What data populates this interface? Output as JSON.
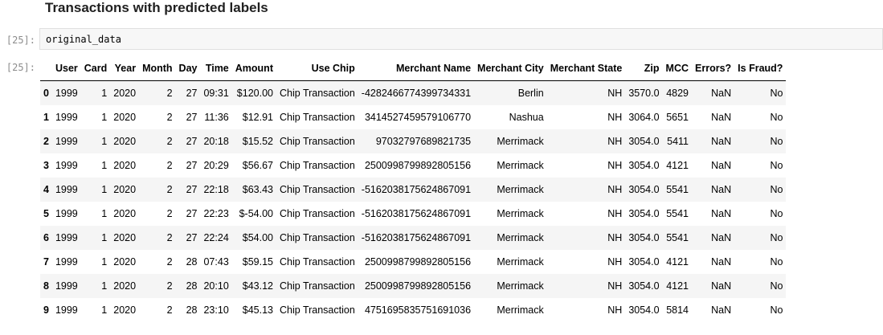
{
  "heading": "Transactions with predicted labels",
  "cell": {
    "in_prompt": "[25]:",
    "code": "original_data",
    "out_prompt": "[25]:"
  },
  "table": {
    "columns": [
      "",
      "User",
      "Card",
      "Year",
      "Month",
      "Day",
      "Time",
      "Amount",
      "Use Chip",
      "Merchant Name",
      "Merchant City",
      "Merchant State",
      "Zip",
      "MCC",
      "Errors?",
      "Is Fraud?"
    ],
    "rows": [
      [
        "0",
        "1999",
        "1",
        "2020",
        "2",
        "27",
        "09:31",
        "$120.00",
        "Chip Transaction",
        "-4282466774399734331",
        "Berlin",
        "NH",
        "3570.0",
        "4829",
        "NaN",
        "No"
      ],
      [
        "1",
        "1999",
        "1",
        "2020",
        "2",
        "27",
        "11:36",
        "$12.91",
        "Chip Transaction",
        "3414527459579106770",
        "Nashua",
        "NH",
        "3064.0",
        "5651",
        "NaN",
        "No"
      ],
      [
        "2",
        "1999",
        "1",
        "2020",
        "2",
        "27",
        "20:18",
        "$15.52",
        "Chip Transaction",
        "97032797689821735",
        "Merrimack",
        "NH",
        "3054.0",
        "5411",
        "NaN",
        "No"
      ],
      [
        "3",
        "1999",
        "1",
        "2020",
        "2",
        "27",
        "20:29",
        "$56.67",
        "Chip Transaction",
        "2500998799892805156",
        "Merrimack",
        "NH",
        "3054.0",
        "4121",
        "NaN",
        "No"
      ],
      [
        "4",
        "1999",
        "1",
        "2020",
        "2",
        "27",
        "22:18",
        "$63.43",
        "Chip Transaction",
        "-5162038175624867091",
        "Merrimack",
        "NH",
        "3054.0",
        "5541",
        "NaN",
        "No"
      ],
      [
        "5",
        "1999",
        "1",
        "2020",
        "2",
        "27",
        "22:23",
        "$-54.00",
        "Chip Transaction",
        "-5162038175624867091",
        "Merrimack",
        "NH",
        "3054.0",
        "5541",
        "NaN",
        "No"
      ],
      [
        "6",
        "1999",
        "1",
        "2020",
        "2",
        "27",
        "22:24",
        "$54.00",
        "Chip Transaction",
        "-5162038175624867091",
        "Merrimack",
        "NH",
        "3054.0",
        "5541",
        "NaN",
        "No"
      ],
      [
        "7",
        "1999",
        "1",
        "2020",
        "2",
        "28",
        "07:43",
        "$59.15",
        "Chip Transaction",
        "2500998799892805156",
        "Merrimack",
        "NH",
        "3054.0",
        "4121",
        "NaN",
        "No"
      ],
      [
        "8",
        "1999",
        "1",
        "2020",
        "2",
        "28",
        "20:10",
        "$43.12",
        "Chip Transaction",
        "2500998799892805156",
        "Merrimack",
        "NH",
        "3054.0",
        "4121",
        "NaN",
        "No"
      ],
      [
        "9",
        "1999",
        "1",
        "2020",
        "2",
        "28",
        "23:10",
        "$45.13",
        "Chip Transaction",
        "4751695835751691036",
        "Merrimack",
        "NH",
        "3054.0",
        "5814",
        "NaN",
        "No"
      ]
    ]
  }
}
